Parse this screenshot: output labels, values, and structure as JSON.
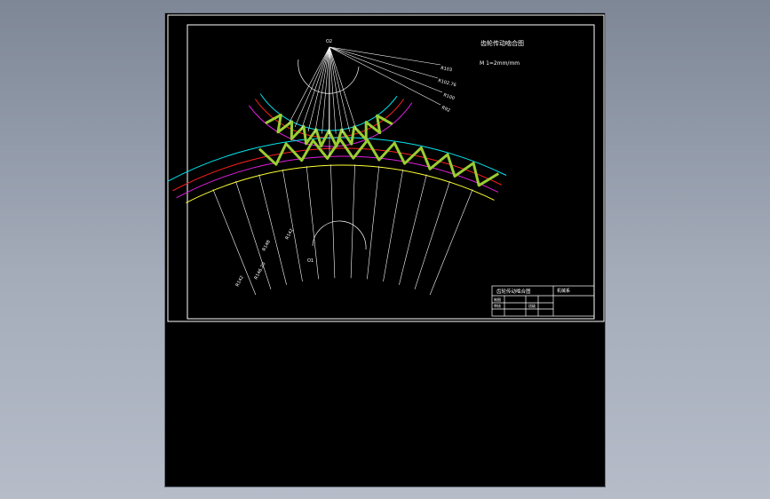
{
  "drawing": {
    "title": "齿轮传动啮合图",
    "scale_note": "M 1=2mm/mm",
    "pinion_center_label": "O2",
    "gear_center_label": "O1",
    "pinion_radius_labels": [
      "R103",
      "R102.76",
      "R100",
      "R92"
    ],
    "gear_radius_labels": [
      "R142",
      "R148",
      "R146.20",
      "R142"
    ],
    "title_block": {
      "name": "齿轮传动啮合图",
      "drawn": "制图",
      "checked": "审核",
      "dept": "机械系",
      "class_label": "班级"
    }
  },
  "colors": {
    "tooth_profile": "#9acd32",
    "addendum_circle": "#00e5ee",
    "pitch_circle": "#ff2020",
    "dedendum_circle": "#e020e0",
    "base_circle": "#ffff30",
    "construction": "#ffffff"
  }
}
